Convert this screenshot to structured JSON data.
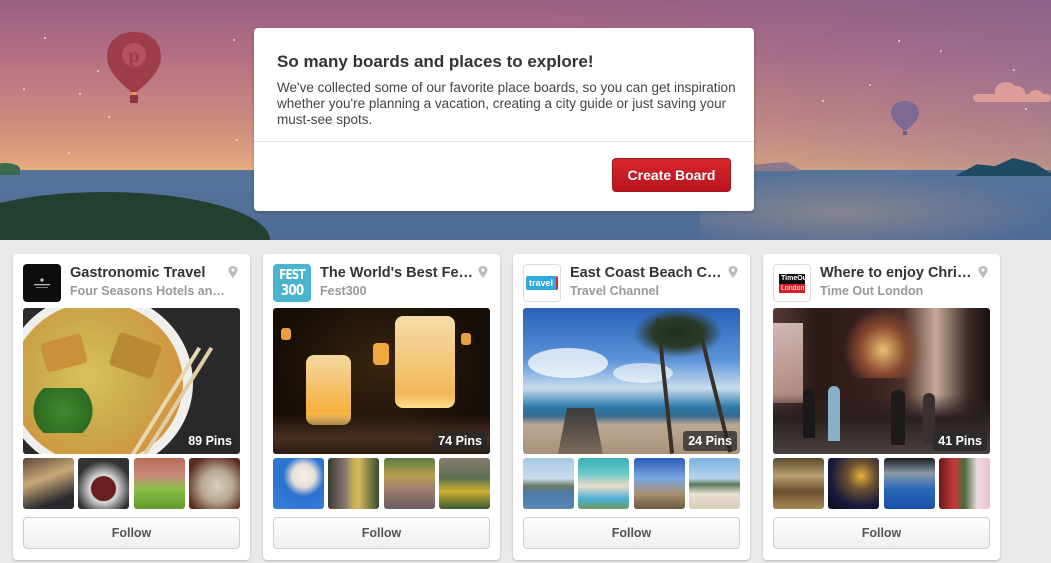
{
  "banner": {
    "illustration": "sunset-sea-with-hot-air-balloons",
    "icons": [
      "pinterest-balloon-icon",
      "small-balloon-icon",
      "cloud-icon",
      "island-icon"
    ]
  },
  "modal": {
    "title": "So many boards and places to explore!",
    "description": "We've collected some of our favorite place boards, so you can get inspiration whether you're planning a vacation, creating a city guide or just saving your must-see spots.",
    "create_board_label": "Create Board"
  },
  "colors": {
    "accent_red": "#cb2027",
    "title_text": "#333333",
    "owner_text": "#999999"
  },
  "boards": [
    {
      "title": "Gastronomic Travel",
      "owner": "Four Seasons Hotels and Resorts",
      "owner_display": "Four Seasons Hotels an…",
      "thumb_icon": "four-seasons-logo",
      "place_icon": "map-pin-icon",
      "cover": "laksa-noodle-soup",
      "pin_count": "89 Pins",
      "thumbs": [
        "sandwich",
        "soup-bowl",
        "green-cocktail",
        "oysters"
      ],
      "follow_label": "Follow"
    },
    {
      "title": "The World's Best Fe…",
      "owner": "Fest300",
      "owner_display": "Fest300",
      "thumb_icon": "fest300-logo",
      "thumb_text_1": "FEST",
      "thumb_text_2": "300",
      "place_icon": "map-pin-icon",
      "cover": "sky-lanterns-festival",
      "pin_count": "74 Pins",
      "thumbs": [
        "hot-air-balloons",
        "golden-statue",
        "crowd-festival",
        "sunflower-parade"
      ],
      "follow_label": "Follow"
    },
    {
      "title": "East Coast Beach C…",
      "owner": "Travel Channel",
      "owner_display": "Travel Channel",
      "thumb_icon": "travel-channel-logo",
      "thumb_text_1": "travel",
      "place_icon": "map-pin-icon",
      "cover": "beach-pier-palm-trees",
      "pin_count": "24 Pins",
      "thumbs": [
        "harbor",
        "resort-pool",
        "lighthouse",
        "shoreline"
      ],
      "follow_label": "Follow"
    },
    {
      "title": "Where to enjoy Chri…",
      "owner": "Time Out London",
      "owner_display": "Time Out London",
      "thumb_icon": "time-out-london-logo",
      "thumb_text_1": "TimeOut",
      "thumb_text_2": "London",
      "place_icon": "map-pin-icon",
      "cover": "christmas-lights-street",
      "pin_count": "41 Pins",
      "thumbs": [
        "restaurant-interior",
        "night-garden-lights",
        "blue-lit-courtyard",
        "christmas-tree"
      ],
      "follow_label": "Follow"
    }
  ]
}
